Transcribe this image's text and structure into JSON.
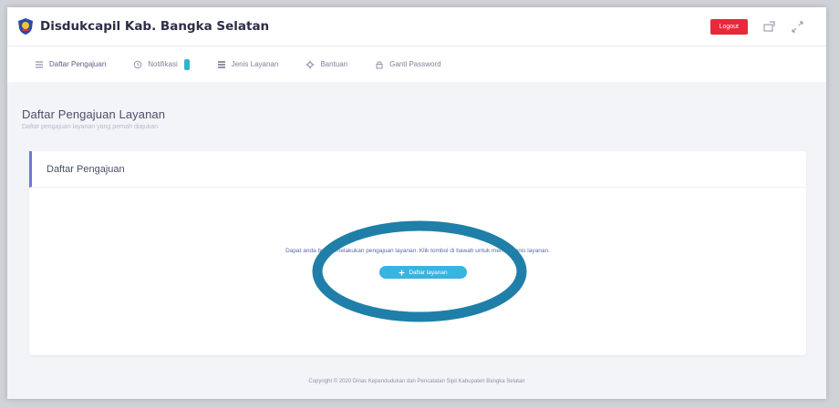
{
  "header": {
    "title": "Disdukcapil Kab. Bangka Selatan",
    "logout_label": "Logout",
    "icons": {
      "logo": "shield-logo-icon",
      "screen": "screen-icon",
      "fullscreen": "fullscreen-icon"
    }
  },
  "tabs": [
    {
      "label": "Daftar Pengajuan",
      "icon": "list-icon"
    },
    {
      "label": "Notifikasi",
      "icon": "bell-icon"
    },
    {
      "label": "Jenis Layanan",
      "icon": "grid-icon"
    },
    {
      "label": "Bantuan",
      "icon": "help-icon"
    },
    {
      "label": "Ganti Password",
      "icon": "lock-icon"
    }
  ],
  "page": {
    "title": "Daftar Pengajuan Layanan",
    "subtitle": "Daftar pengajuan layanan yang pernah diajukan"
  },
  "card": {
    "title": "Daftar Pengajuan",
    "empty_message": "Dapat anda belum melakukan pengajuan layanan. Klik tombol di bawah untuk memilih jenis layanan.",
    "button_label": "Daftar layanan"
  },
  "footer": {
    "copyright": "Copyright © 2020 Dinas Kependudukan dan Pencatatan Sipil Kabupaten Bangka Selatan"
  },
  "colors": {
    "accent": "#39b3e0",
    "logout": "#e8283b",
    "card_accent": "#6f79d4",
    "highlight": "#1f7fa8"
  }
}
